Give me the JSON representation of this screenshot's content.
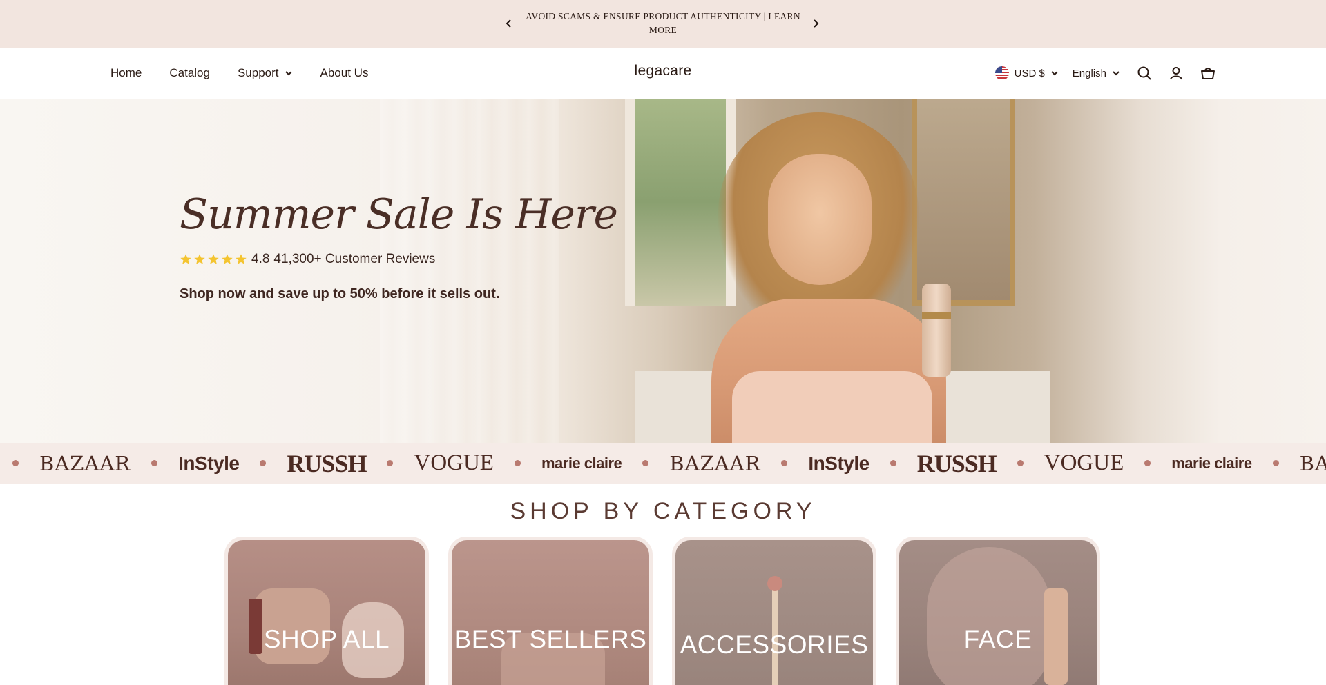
{
  "announcement": {
    "message": "AVOID SCAMS & ENSURE PRODUCT AUTHENTICITY | LEARN MORE",
    "prev_icon": "chevron-left-icon",
    "next_icon": "chevron-right-icon"
  },
  "header": {
    "nav": [
      {
        "label": "Home",
        "has_dropdown": false
      },
      {
        "label": "Catalog",
        "has_dropdown": false
      },
      {
        "label": "Support",
        "has_dropdown": true
      },
      {
        "label": "About Us",
        "has_dropdown": false
      }
    ],
    "logo": "legacare",
    "currency": "USD $",
    "language": "English",
    "icons": [
      "search-icon",
      "account-icon",
      "cart-icon"
    ]
  },
  "hero": {
    "title": "Summer Sale Is Here",
    "rating_value": "4.8",
    "reviews_text": "41,300+ Customer Reviews",
    "stars": 5,
    "subtitle": "Shop now and save up to 50% before it sells out."
  },
  "press": {
    "logos": [
      "BAZAAR",
      "InStyle",
      "RUSSH",
      "VOGUE",
      "marie claire",
      "BAZAAR",
      "InStyle",
      "RUSSH",
      "VOGUE",
      "marie claire",
      "BAZAAR"
    ]
  },
  "categories": {
    "title": "SHOP BY CATEGORY",
    "items": [
      {
        "label": "SHOP ALL"
      },
      {
        "label": "BEST SELLERS"
      },
      {
        "label": "ACCESSORIES"
      },
      {
        "label": "FACE"
      }
    ]
  },
  "colors": {
    "announcement_bg": "#f2e5df",
    "text_dark": "#3a2620",
    "accent_dot": "#b97a70",
    "star": "#f4c430"
  }
}
